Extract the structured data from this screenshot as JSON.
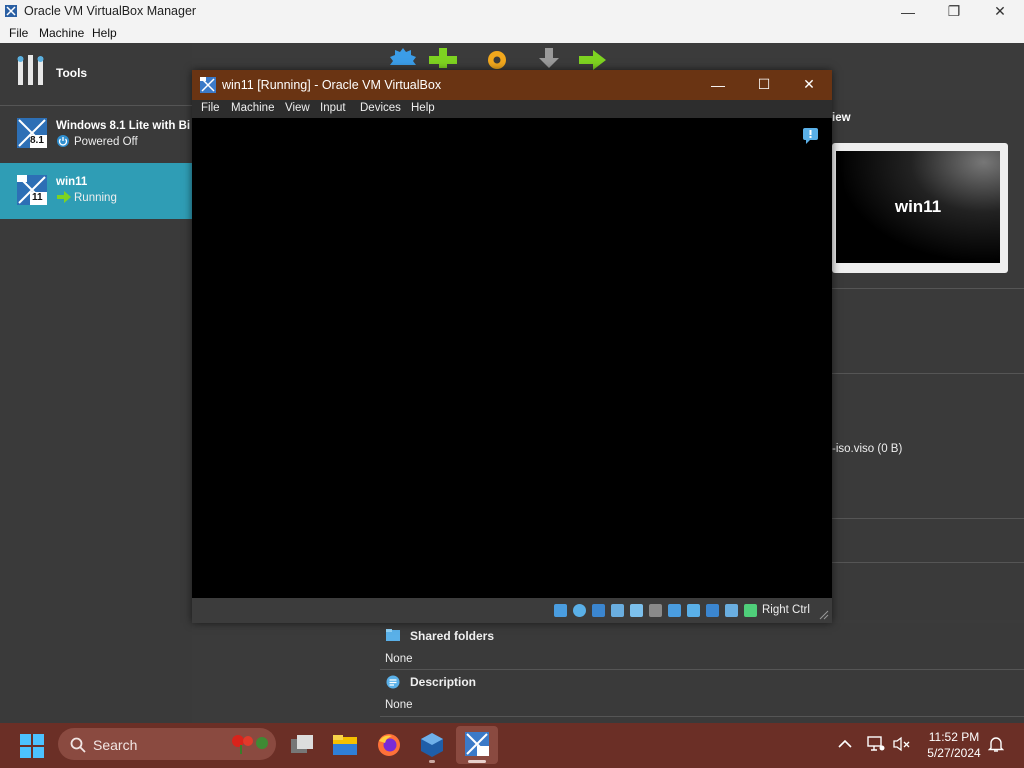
{
  "manager": {
    "title": "Oracle VM VirtualBox Manager",
    "menu": [
      "File",
      "Machine",
      "Help"
    ],
    "window_controls": {
      "minimize": "—",
      "restore": "❐",
      "close": "✕"
    }
  },
  "sidebar": {
    "tools_label": "Tools",
    "vms": [
      {
        "name": "Windows 8.1 Lite with Bi",
        "state": "Powered Off",
        "badge": "8.1"
      },
      {
        "name": "win11",
        "state": "Running",
        "badge": "11"
      }
    ]
  },
  "details": {
    "preview_header": "iew",
    "preview_text": "win11",
    "storage_fragment": "-iso.viso (0 B)",
    "shared_folders_label": "Shared folders",
    "shared_folders_value": "None",
    "description_label": "Description",
    "description_value": "None"
  },
  "vm_window": {
    "title": "win11 [Running] - Oracle VM VirtualBox",
    "menu": [
      "File",
      "Machine",
      "View",
      "Input",
      "Devices",
      "Help"
    ],
    "host_key": "Right Ctrl",
    "window_controls": {
      "minimize": "—",
      "maximize": "☐",
      "close": "✕"
    }
  },
  "taskbar": {
    "search_label": "Search",
    "time": "11:52 PM",
    "date": "5/27/2024"
  },
  "colors": {
    "selected_vm_bg": "#2f9db5",
    "vm_titlebar": "#6a3413",
    "taskbar": "#6b2f26"
  }
}
